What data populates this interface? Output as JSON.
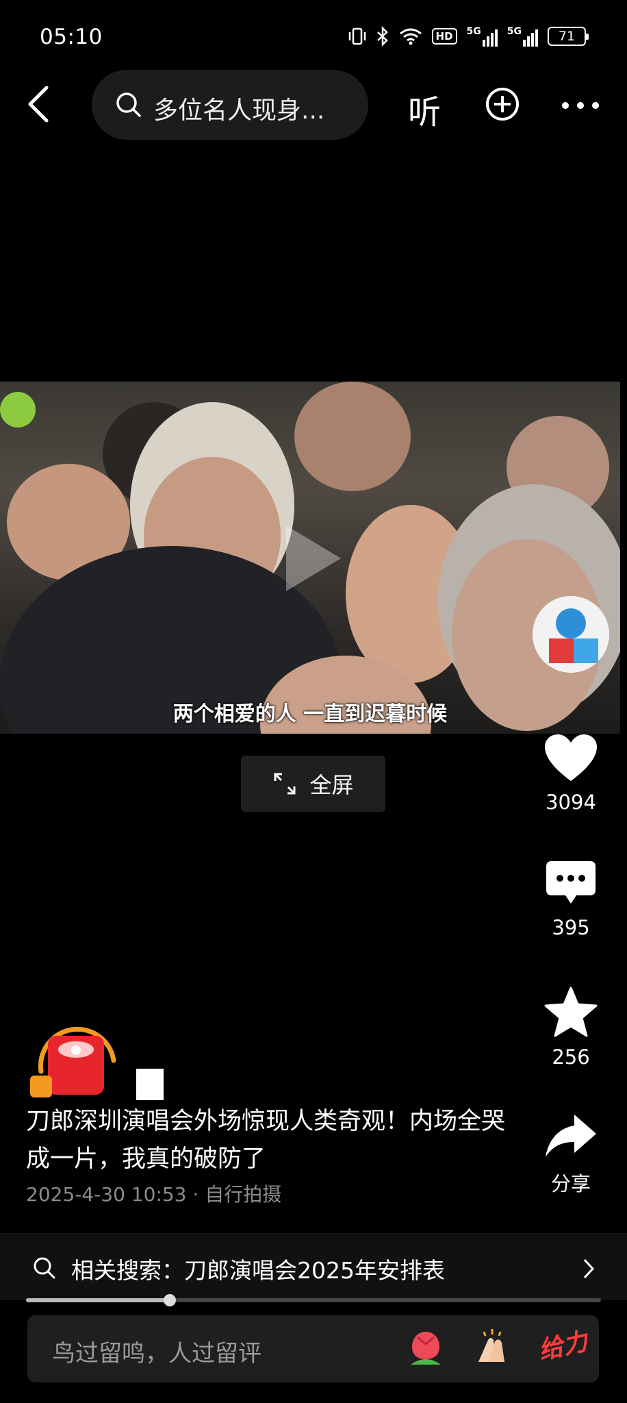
{
  "status_bar": {
    "time": "05:10",
    "hd_label": "HD",
    "net1": "5G",
    "net2": "5G",
    "battery": "71"
  },
  "top_nav": {
    "search_query": "多位名人现身...",
    "listen_label": "听"
  },
  "video": {
    "subtitle": "两个相爱的人 一直到迟暮时候",
    "fullscreen_label": "全屏"
  },
  "actions": {
    "likes": "3094",
    "comments": "395",
    "favorites": "256",
    "share_label": "分享"
  },
  "post": {
    "caption": "刀郎深圳演唱会外场惊现人类奇观！内场全哭成一片，我真的破防了",
    "meta": "2025-4-30 10:53 · 自行拍摄"
  },
  "related_search": {
    "label": "相关搜索：刀郎演唱会2025年安排表"
  },
  "progress": {
    "fraction": 0.25
  },
  "comment_bar": {
    "placeholder": "鸟过留鸣，人过留评",
    "gift_label": "给力"
  },
  "colors": {
    "background": "#000000",
    "surface": "#1f1f1f",
    "meta_text": "#8c8c8c",
    "accent_red": "#ff3b3b"
  }
}
